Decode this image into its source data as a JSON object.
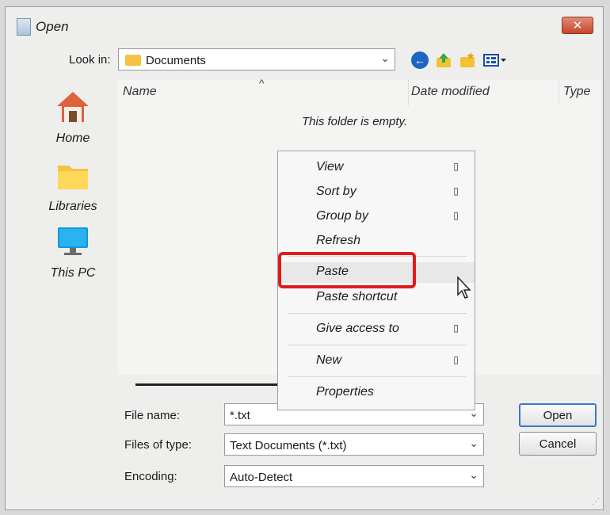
{
  "window": {
    "title": "Open",
    "close_label": "✕"
  },
  "toolbar": {
    "look_in_label": "Look in:",
    "look_in_value": "Documents",
    "back_icon": "back-arrow-icon",
    "up_icon": "up-folder-icon",
    "new_folder_icon": "new-folder-icon",
    "view_menu_icon": "view-menu-icon"
  },
  "places": [
    {
      "label": "Home",
      "icon": "home-icon"
    },
    {
      "label": "Libraries",
      "icon": "libraries-icon"
    },
    {
      "label": "This PC",
      "icon": "this-pc-icon"
    }
  ],
  "file_list": {
    "columns": [
      "Name",
      "Date modified",
      "Type"
    ],
    "empty_message": "This folder is empty."
  },
  "context_menu": {
    "items": [
      {
        "label": "View",
        "has_submenu": true
      },
      {
        "label": "Sort by",
        "has_submenu": true
      },
      {
        "label": "Group by",
        "has_submenu": true
      },
      {
        "label": "Refresh",
        "has_submenu": false
      },
      {
        "label": "Paste",
        "has_submenu": false,
        "highlighted": true
      },
      {
        "label": "Paste shortcut",
        "has_submenu": false
      },
      {
        "label": "Give access to",
        "has_submenu": true
      },
      {
        "label": "New",
        "has_submenu": true
      },
      {
        "label": "Properties",
        "has_submenu": false
      }
    ],
    "submenu_glyph": "▯",
    "highlight_color": "#e11b1b"
  },
  "form": {
    "file_name_label": "File name:",
    "file_name_value": "*.txt",
    "file_type_label": "Files of type:",
    "file_type_value": "Text Documents (*.txt)",
    "encoding_label": "Encoding:",
    "encoding_value": "Auto-Detect"
  },
  "buttons": {
    "open": "Open",
    "cancel": "Cancel"
  },
  "colors": {
    "accent": "#3b79c9",
    "folder": "#f5c342",
    "close": "#c8452c"
  }
}
